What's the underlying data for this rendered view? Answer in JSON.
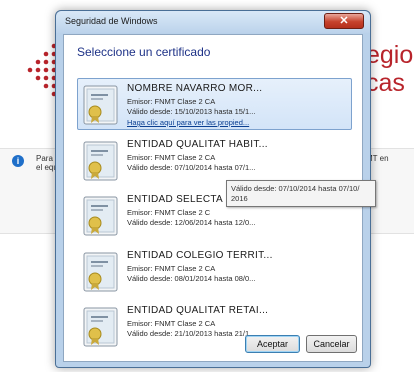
{
  "background": {
    "logo_line1": "egios",
    "logo_line2": "cas",
    "notice_left_1": "Para a",
    "notice_left_2": "el equ",
    "notice_right_1": "MT en",
    "notice_right_2": "",
    "brand_color": "#b8242b"
  },
  "dialog": {
    "title": "Seguridad de Windows",
    "close_label": "✕",
    "heading": "Seleccione un certificado",
    "certificates": [
      {
        "name": "NOMBRE NAVARRO MOR...",
        "issuer": "Emisor: FNMT Clase 2 CA",
        "valid": "Válido desde: 15/10/2013 hasta 15/1...",
        "link": "Haga clic aquí para ver las propied..."
      },
      {
        "name": "ENTIDAD QUALITAT HABIT...",
        "issuer": "Emisor: FNMT Clase 2 CA",
        "valid": "Válido desde: 07/10/2014 hasta 07/1..."
      },
      {
        "name": "ENTIDAD SELECTA",
        "issuer": "Emisor: FNMT Clase 2 C",
        "valid": "Válido desde: 12/06/2014 hasta 12/0..."
      },
      {
        "name": "ENTIDAD COLEGIO TERRIT...",
        "issuer": "Emisor: FNMT Clase 2 CA",
        "valid": "Válido desde: 08/01/2014 hasta 08/0..."
      },
      {
        "name": "ENTIDAD QUALITAT RETAI...",
        "issuer": "Emisor: FNMT Clase 2 CA",
        "valid": "Válido desde: 21/10/2013 hasta 21/1..."
      }
    ],
    "tooltip": {
      "line1": "Válido desde: 07/10/2014 hasta 07/10/",
      "line2": "2016"
    },
    "buttons": {
      "accept": "Aceptar",
      "cancel": "Cancelar"
    },
    "icon": "certificate-icon"
  }
}
